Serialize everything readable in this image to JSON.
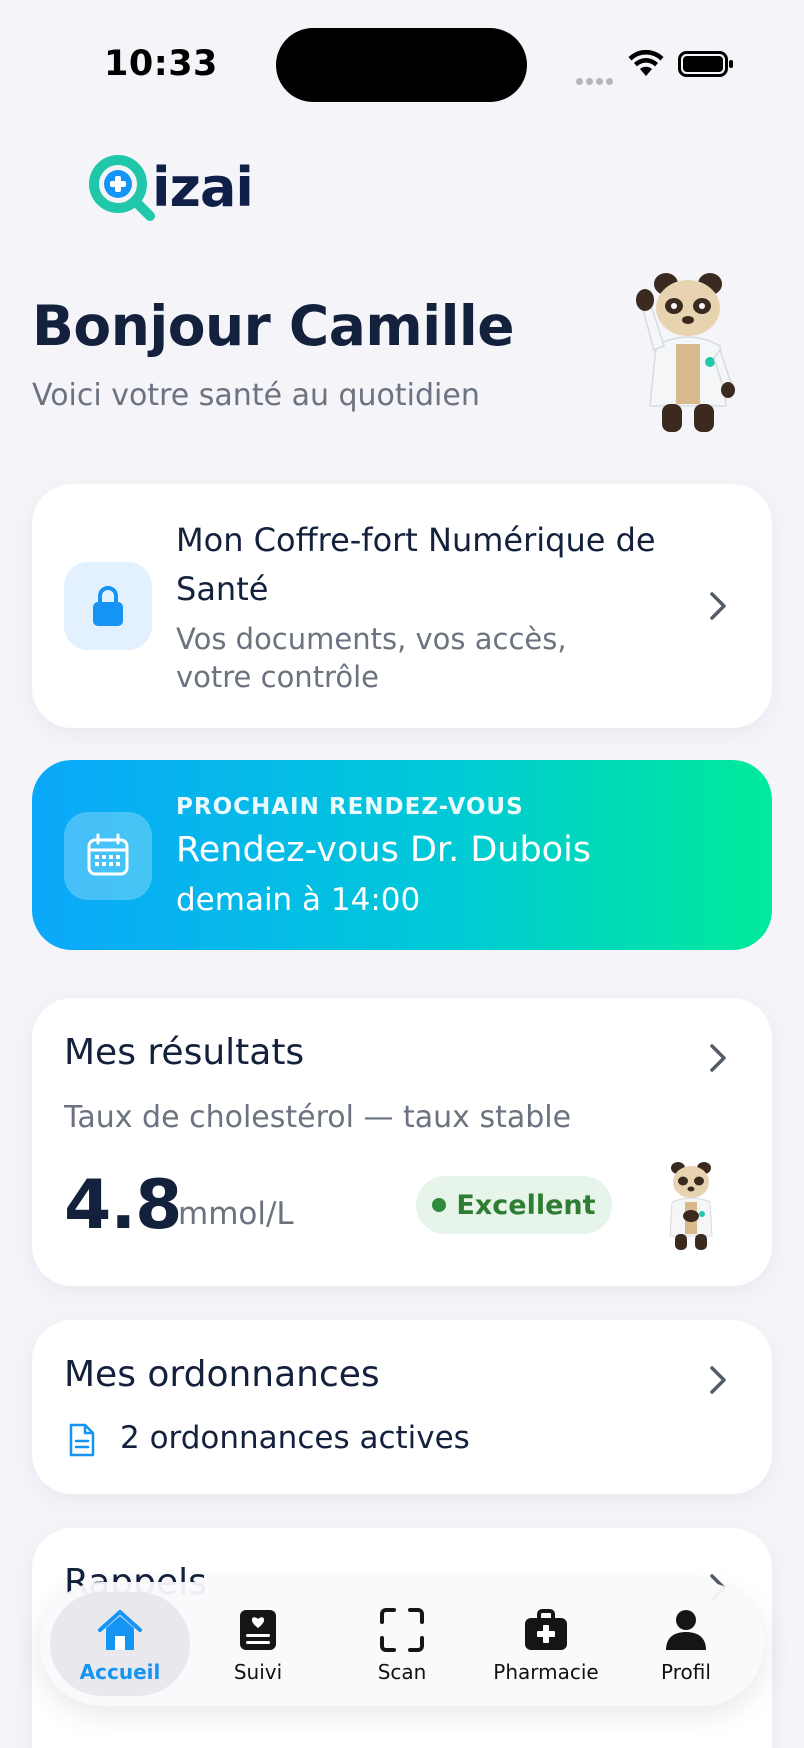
{
  "status_bar": {
    "time": "10:33"
  },
  "app": {
    "logo_text": "izai",
    "brand_color": "#20c7a8",
    "accent_color": "#1594f3"
  },
  "header": {
    "greeting": "Bonjour Camille",
    "subtitle": "Voici votre santé au quotidien"
  },
  "vault": {
    "title": "Mon Coffre-fort Numérique de Santé",
    "subtitle": "Vos documents, vos accès, votre contrôle",
    "icon": "lock-icon"
  },
  "appointment": {
    "label": "PROCHAIN RENDEZ-VOUS",
    "title": "Rendez-vous Dr. Dubois",
    "time": "demain à 14:00",
    "icon": "calendar-icon"
  },
  "results": {
    "title": "Mes résultats",
    "subtitle": "Taux de cholestérol — taux stable",
    "value": "4.8",
    "unit": "mmol/L",
    "badge": "Excellent",
    "badge_color": "#2e7d32"
  },
  "prescriptions": {
    "title": "Mes ordonnances",
    "summary": "2 ordonnances actives",
    "icon": "document-icon"
  },
  "reminders": {
    "title": "Rappels"
  },
  "tab_bar": {
    "tabs": [
      {
        "label": "Accueil",
        "icon": "home-icon",
        "active": true
      },
      {
        "label": "Suivi",
        "icon": "journal-icon",
        "active": false
      },
      {
        "label": "Scan",
        "icon": "scan-icon",
        "active": false
      },
      {
        "label": "Pharmacie",
        "icon": "medkit-icon",
        "active": false
      },
      {
        "label": "Profil",
        "icon": "person-icon",
        "active": false
      }
    ]
  }
}
